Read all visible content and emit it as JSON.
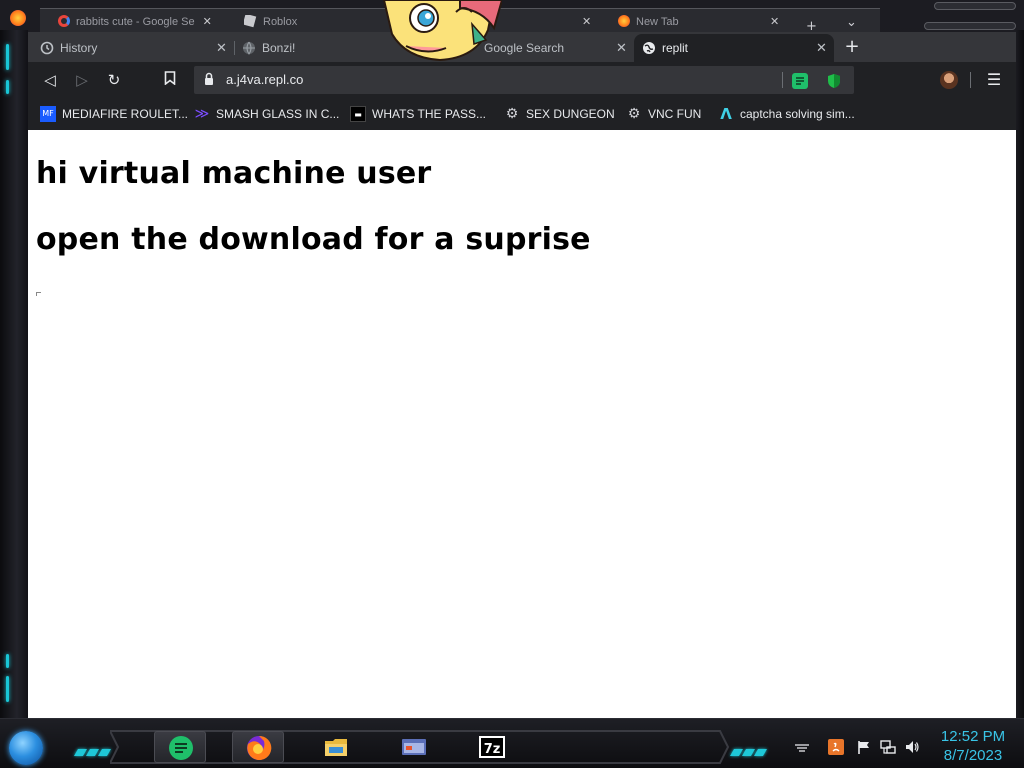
{
  "background_window": {
    "tabs": [
      {
        "title": "rabbits cute - Google Se",
        "close": "✕"
      },
      {
        "title": "Roblox",
        "close": "✕"
      },
      {
        "title": "New Tab",
        "close": "✕"
      }
    ],
    "new_tab_symbol": "+",
    "dropdown_symbol": "⌄"
  },
  "browser": {
    "tabs": [
      {
        "title": "History",
        "icon": "history-icon",
        "close": "✕",
        "active": false
      },
      {
        "title": "Bonzi!",
        "icon": "globe-icon",
        "close": "",
        "active": false
      },
      {
        "title": "Google Search",
        "icon": "google-icon",
        "close": "✕",
        "active": false
      },
      {
        "title": "replit",
        "icon": "globe-icon",
        "close": "✕",
        "active": true
      }
    ],
    "new_tab_symbol": "+",
    "toolbar": {
      "back": "◁",
      "forward": "▷",
      "reload": "↻",
      "bookmark": "🔖",
      "url": "a.j4va.repl.co",
      "menu": "☰"
    },
    "bookmarks": [
      {
        "label": "MEDIAFIRE ROULET...",
        "icon": "mediafire-icon",
        "icon_text": "MF",
        "color": "#1a5cff"
      },
      {
        "label": "SMASH GLASS IN C...",
        "icon": "power-apps-icon",
        "icon_text": "≫",
        "color": "#5b2de0"
      },
      {
        "label": "WHATS THE PASS...",
        "icon": "dark-square-icon",
        "icon_text": "▬",
        "color": "#111111"
      },
      {
        "label": "SEX DUNGEON",
        "icon": "gear-bot-icon",
        "icon_text": "⚙",
        "color": "#202124"
      },
      {
        "label": "VNC FUN",
        "icon": "gear-bot-icon",
        "icon_text": "⚙",
        "color": "#202124"
      },
      {
        "label": "captcha solving sim...",
        "icon": "lambda-icon",
        "icon_text": "Λ",
        "color": "#202124"
      }
    ]
  },
  "page": {
    "heading1": "hi virtual machine user",
    "heading2": "open the download for a suprise"
  },
  "taskbar": {
    "clock_time": "12:52 PM",
    "clock_date": "8/7/2023",
    "accent": "#1ec8d8"
  }
}
